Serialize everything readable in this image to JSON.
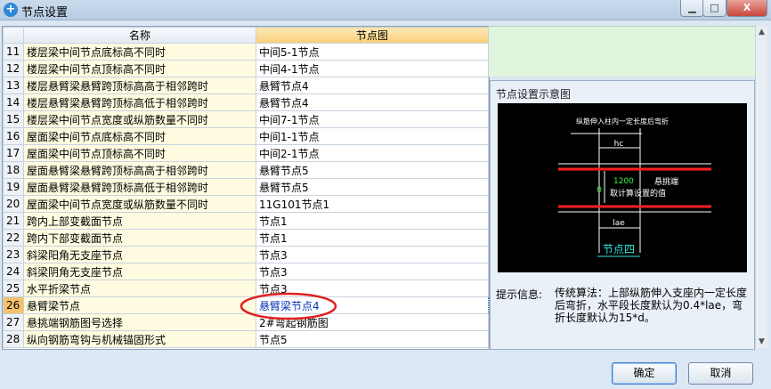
{
  "window": {
    "title": "节点设置",
    "min_label": "▁",
    "max_label": "□",
    "close_label": "X"
  },
  "table": {
    "headers": [
      "名称",
      "节点图"
    ],
    "rows": [
      {
        "num": "11",
        "name": "楼层梁中间节点底标高不同时",
        "node": "中间5-1节点"
      },
      {
        "num": "12",
        "name": "楼层梁中间节点顶标高不同时",
        "node": "中间4-1节点"
      },
      {
        "num": "13",
        "name": "楼层悬臂梁悬臂跨顶标高高于相邻跨时",
        "node": "悬臂节点4"
      },
      {
        "num": "14",
        "name": "楼层悬臂梁悬臂跨顶标高低于相邻跨时",
        "node": "悬臂节点4"
      },
      {
        "num": "15",
        "name": "楼层梁中间节点宽度或纵筋数量不同时",
        "node": "中间7-1节点"
      },
      {
        "num": "16",
        "name": "屋面梁中间节点底标高不同时",
        "node": "中间1-1节点"
      },
      {
        "num": "17",
        "name": "屋面梁中间节点顶标高不同时",
        "node": "中间2-1节点"
      },
      {
        "num": "18",
        "name": "屋面悬臂梁悬臂跨顶标高高于相邻跨时",
        "node": "悬臂节点5"
      },
      {
        "num": "19",
        "name": "屋面悬臂梁悬臂跨顶标高低于相邻跨时",
        "node": "悬臂节点5"
      },
      {
        "num": "20",
        "name": "屋面梁中间节点宽度或纵筋数量不同时",
        "node": "11G101节点1"
      },
      {
        "num": "21",
        "name": "跨内上部变截面节点",
        "node": "节点1"
      },
      {
        "num": "22",
        "name": "跨内下部变截面节点",
        "node": "节点1"
      },
      {
        "num": "23",
        "name": "斜梁阳角无支座节点",
        "node": "节点3"
      },
      {
        "num": "24",
        "name": "斜梁阴角无支座节点",
        "node": "节点3"
      },
      {
        "num": "25",
        "name": "水平折梁节点",
        "node": "节点3"
      },
      {
        "num": "26",
        "name": "悬臂梁节点",
        "node": "悬臂梁节点4"
      },
      {
        "num": "27",
        "name": "悬挑端钢筋图号选择",
        "node": "2#弯起钢筋图"
      },
      {
        "num": "28",
        "name": "纵向钢筋弯钩与机械锚固形式",
        "node": "节点5"
      }
    ],
    "selected_row": "26"
  },
  "diagram_panel": {
    "title": "节点设置示意图",
    "drawing": {
      "top_text": "纵筋伸入柱内一定长度后弯折",
      "hc": "hc",
      "value_1200": "1200",
      "cantilever_label": "悬挑端",
      "zero": "0",
      "calc_text": "取计算设置的值",
      "lae": "lae",
      "node_title": "节点四"
    },
    "info_label": "提示信息:",
    "info_text": "传统算法：上部纵筋伸入支座内一定长度后弯折，水平段长度默认为0.4*lae，弯折长度默认为15*d。"
  },
  "buttons": {
    "ok": "确定",
    "cancel": "取消"
  },
  "colors": {
    "selection_highlight": "#f5c26a",
    "annotation_circle": "#e02020",
    "rebar_red": "#ff2020"
  }
}
